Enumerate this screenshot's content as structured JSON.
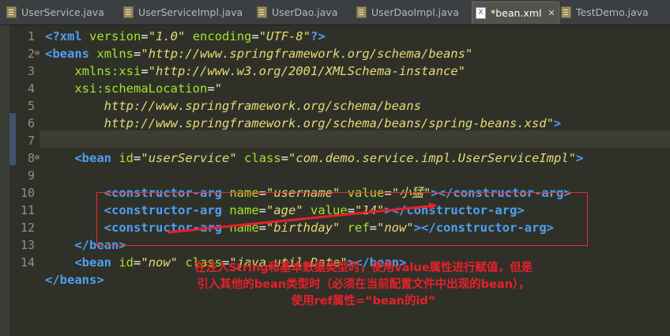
{
  "tabs": [
    {
      "label": "UserService.java",
      "icon": "java-file-icon",
      "active": false
    },
    {
      "label": "UserServiceImpl.java",
      "icon": "java-file-icon",
      "active": false
    },
    {
      "label": "UserDao.java",
      "icon": "java-file-icon",
      "active": false
    },
    {
      "label": "UserDaoImpl.java",
      "icon": "java-file-icon",
      "active": false
    },
    {
      "label": "*bean.xml",
      "icon": "xml-file-icon",
      "active": true
    },
    {
      "label": "TestDemo.java",
      "icon": "java-file-icon",
      "active": false
    }
  ],
  "close_glyph": "✕",
  "line_numbers": [
    "1",
    "2",
    "3",
    "4",
    "5",
    "6",
    "7",
    "8",
    "9",
    "10",
    "11",
    "12",
    "13",
    "14"
  ],
  "code": {
    "l1": {
      "open": "<?",
      "tag": "xml",
      "a1": "version",
      "v1": "\"1.0\"",
      "a2": "encoding",
      "v2": "\"UTF-8\"",
      "close": "?>"
    },
    "l2": {
      "lt": "<",
      "tag": "beans",
      "attr": "xmlns",
      "val": "\"http://www.springframework.org/schema/beans\""
    },
    "l3": {
      "attr": "xmlns:xsi",
      "val": "\"http://www.w3.org/2001/XMLSchema-instance\""
    },
    "l4": {
      "attr": "xsi:schemaLocation",
      "val": "\""
    },
    "l5": {
      "val": "http://www.springframework.org/schema/beans"
    },
    "l6": {
      "val": "http://www.springframework.org/schema/beans/spring-beans.xsd\"",
      "close": ">"
    },
    "l8": {
      "lt": "<",
      "tag": "bean",
      "a1": "id",
      "v1": "\"userService\"",
      "a2": "class",
      "v2": "\"com.demo.service.impl.UserServiceImpl\"",
      "close": ">"
    },
    "l9": {
      "tag": "constructor-arg",
      "a1": "name",
      "v1": "\"username\"",
      "a2": "value",
      "v2": "\"小猛\""
    },
    "l10": {
      "tag": "constructor-arg",
      "a1": "name",
      "v1": "\"age\"",
      "a2": "value",
      "v2": "\"14\""
    },
    "l11": {
      "tag": "constructor-arg",
      "a1": "name",
      "v1": "\"birthday\"",
      "a2": "ref",
      "v2": "\"now\""
    },
    "l12": {
      "tag": "bean"
    },
    "l13": {
      "tag": "bean",
      "a1": "id",
      "v1": "\"now\"",
      "a2": "class",
      "v2": "\"java.util.Date\"",
      "end": "bean"
    },
    "l14": {
      "tag": "beans"
    }
  },
  "annotation": {
    "line1": "在注入String和基本数据类型时，使用value属性进行赋值，但是",
    "line2": "引入其他的bean类型时（必须在当前配置文件中出现的bean），",
    "line3": "使用ref属性=“bean的id”"
  },
  "colors": {
    "tag": "#4f9ff2",
    "attribute": "#a6e22e",
    "value": "#e6db74",
    "annotation": "#e8202a"
  }
}
